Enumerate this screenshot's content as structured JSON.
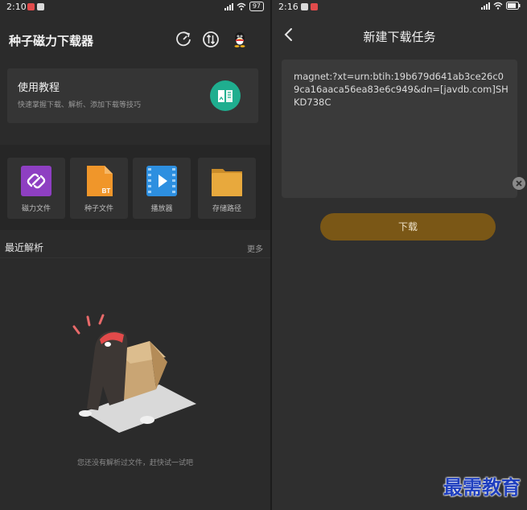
{
  "left": {
    "status": {
      "time": "2:10",
      "battery": "97"
    },
    "app_title": "种子磁力下载器",
    "tutorial": {
      "title": "使用教程",
      "subtitle": "快速掌握下载、解析、添加下载等技巧"
    },
    "tiles": [
      {
        "label": "磁力文件",
        "icon": "magnet-link-icon",
        "color": "#8e3fc2"
      },
      {
        "label": "种子文件",
        "icon": "bt-file-icon",
        "color": "#f0962a",
        "badge": "BT"
      },
      {
        "label": "播放器",
        "icon": "player-icon",
        "color": "#2d8fe0"
      },
      {
        "label": "存储路径",
        "icon": "folder-icon",
        "color": "#e8a93d"
      }
    ],
    "recent": {
      "title": "最近解析",
      "more": "更多",
      "empty_text": "您还没有解析过文件，赶快试一试吧"
    }
  },
  "right": {
    "status": {
      "time": "2:16"
    },
    "title": "新建下载任务",
    "magnet_value": "magnet:?xt=urn:btih:19b679d641ab3ce26c09ca16aaca56ea83e6c949&dn=[javdb.com]SHKD738C",
    "download_label": "下载"
  },
  "watermark": "最需教育",
  "colors": {
    "accent_button": "#7a5716",
    "tutorial_icon": "#1fae8f"
  }
}
